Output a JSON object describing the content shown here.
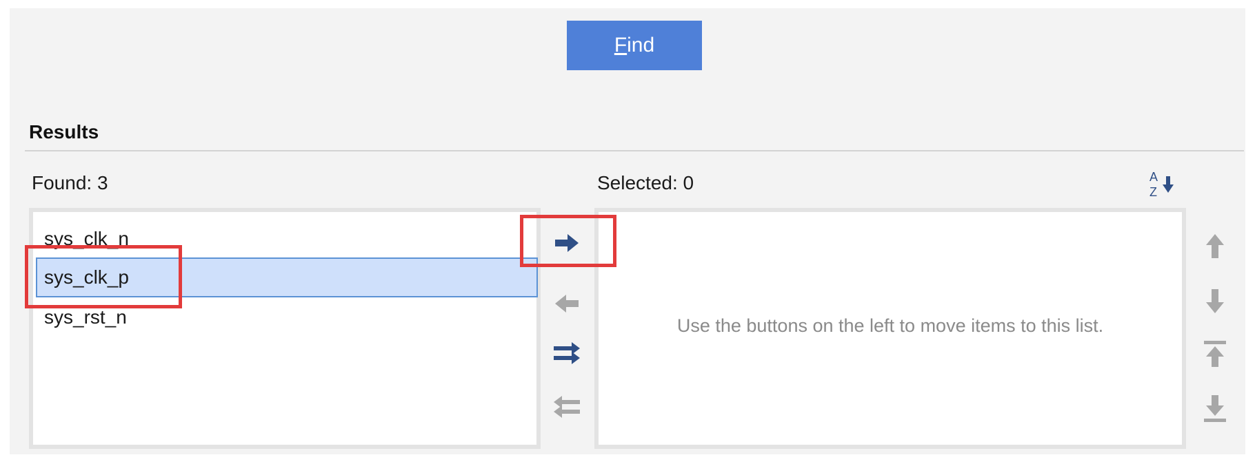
{
  "find_button": {
    "mnemonic": "F",
    "rest": "ind"
  },
  "results": {
    "title": "Results",
    "found_label": "Found: 3",
    "selected_label": "Selected: 0",
    "found_items": [
      {
        "label": "sys_clk_n",
        "selected": false
      },
      {
        "label": "sys_clk_p",
        "selected": true
      },
      {
        "label": "sys_rst_n",
        "selected": false
      }
    ],
    "selected_items": [],
    "empty_message": "Use the buttons on the left to move items to this list."
  },
  "transfer_buttons": [
    {
      "icon": "arrow-right-icon",
      "enabled": true
    },
    {
      "icon": "arrow-left-icon",
      "enabled": false
    },
    {
      "icon": "move-all-right-icon",
      "enabled": true
    },
    {
      "icon": "move-all-left-icon",
      "enabled": false
    }
  ],
  "order_buttons": [
    {
      "icon": "move-up-icon"
    },
    {
      "icon": "move-down-icon"
    },
    {
      "icon": "move-to-top-icon"
    },
    {
      "icon": "move-to-bottom-icon"
    }
  ],
  "sort_icon": {
    "icon": "sort-alphabetical-icon",
    "top_letter": "A",
    "bottom_letter": "Z"
  },
  "colors": {
    "accent": "#4f80d8",
    "enabled_icon": "#2f4f86",
    "disabled_icon": "#a7a7a7",
    "selection": "#cfe0fb",
    "annotation": "#e23b3b"
  }
}
